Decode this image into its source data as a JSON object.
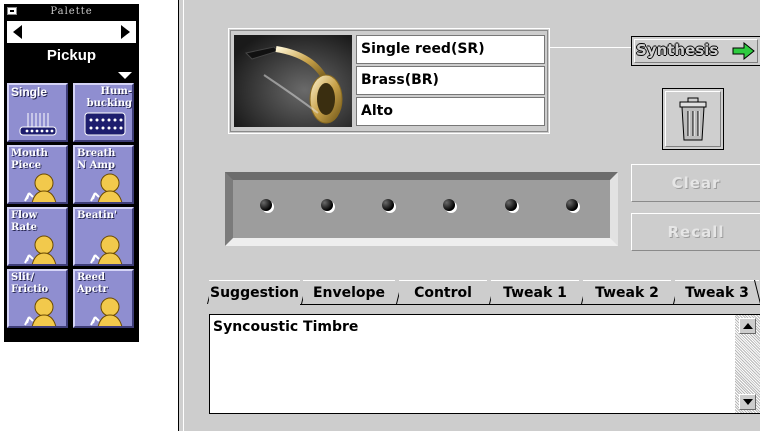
{
  "palette": {
    "title": "Palette",
    "category": "Pickup",
    "buttons": [
      {
        "label": "Single",
        "icon": "single-pickup-icon"
      },
      {
        "label": "Hum-\nbucking",
        "icon": "humbucking-pickup-icon"
      },
      {
        "label": "Mouth\nPiece",
        "icon": "mouthpiece-mic-icon"
      },
      {
        "label": "Breath\nN Amp",
        "icon": "breath-amp-mic-icon"
      },
      {
        "label": "Flow\nRate",
        "icon": "flow-rate-mic-icon"
      },
      {
        "label": "Beatin'",
        "icon": "beatin-mic-icon"
      },
      {
        "label": "Slit/\nFrictio",
        "icon": "slit-friction-mic-icon"
      },
      {
        "label": "Reed\nApctr",
        "icon": "reed-aperture-mic-icon"
      }
    ]
  },
  "instrument": {
    "fields": [
      "Single reed(SR)",
      "Brass(BR)",
      "Alto"
    ],
    "photo": "saxophone-photo"
  },
  "buttons": {
    "synthesis": "Synthesis",
    "clear": "Clear",
    "recall": "Recall"
  },
  "dots_count": 6,
  "tabs": [
    "Suggestion",
    "Envelope",
    "Control",
    "Tweak 1",
    "Tweak 2",
    "Tweak 3"
  ],
  "active_tab": "Suggestion",
  "text_area": {
    "content": "Syncoustic Timbre"
  },
  "colors": {
    "palette_button": "#8f8ed0",
    "window_bg": "#cdcdcd",
    "synthesis_arrow": "#2ecc40"
  }
}
